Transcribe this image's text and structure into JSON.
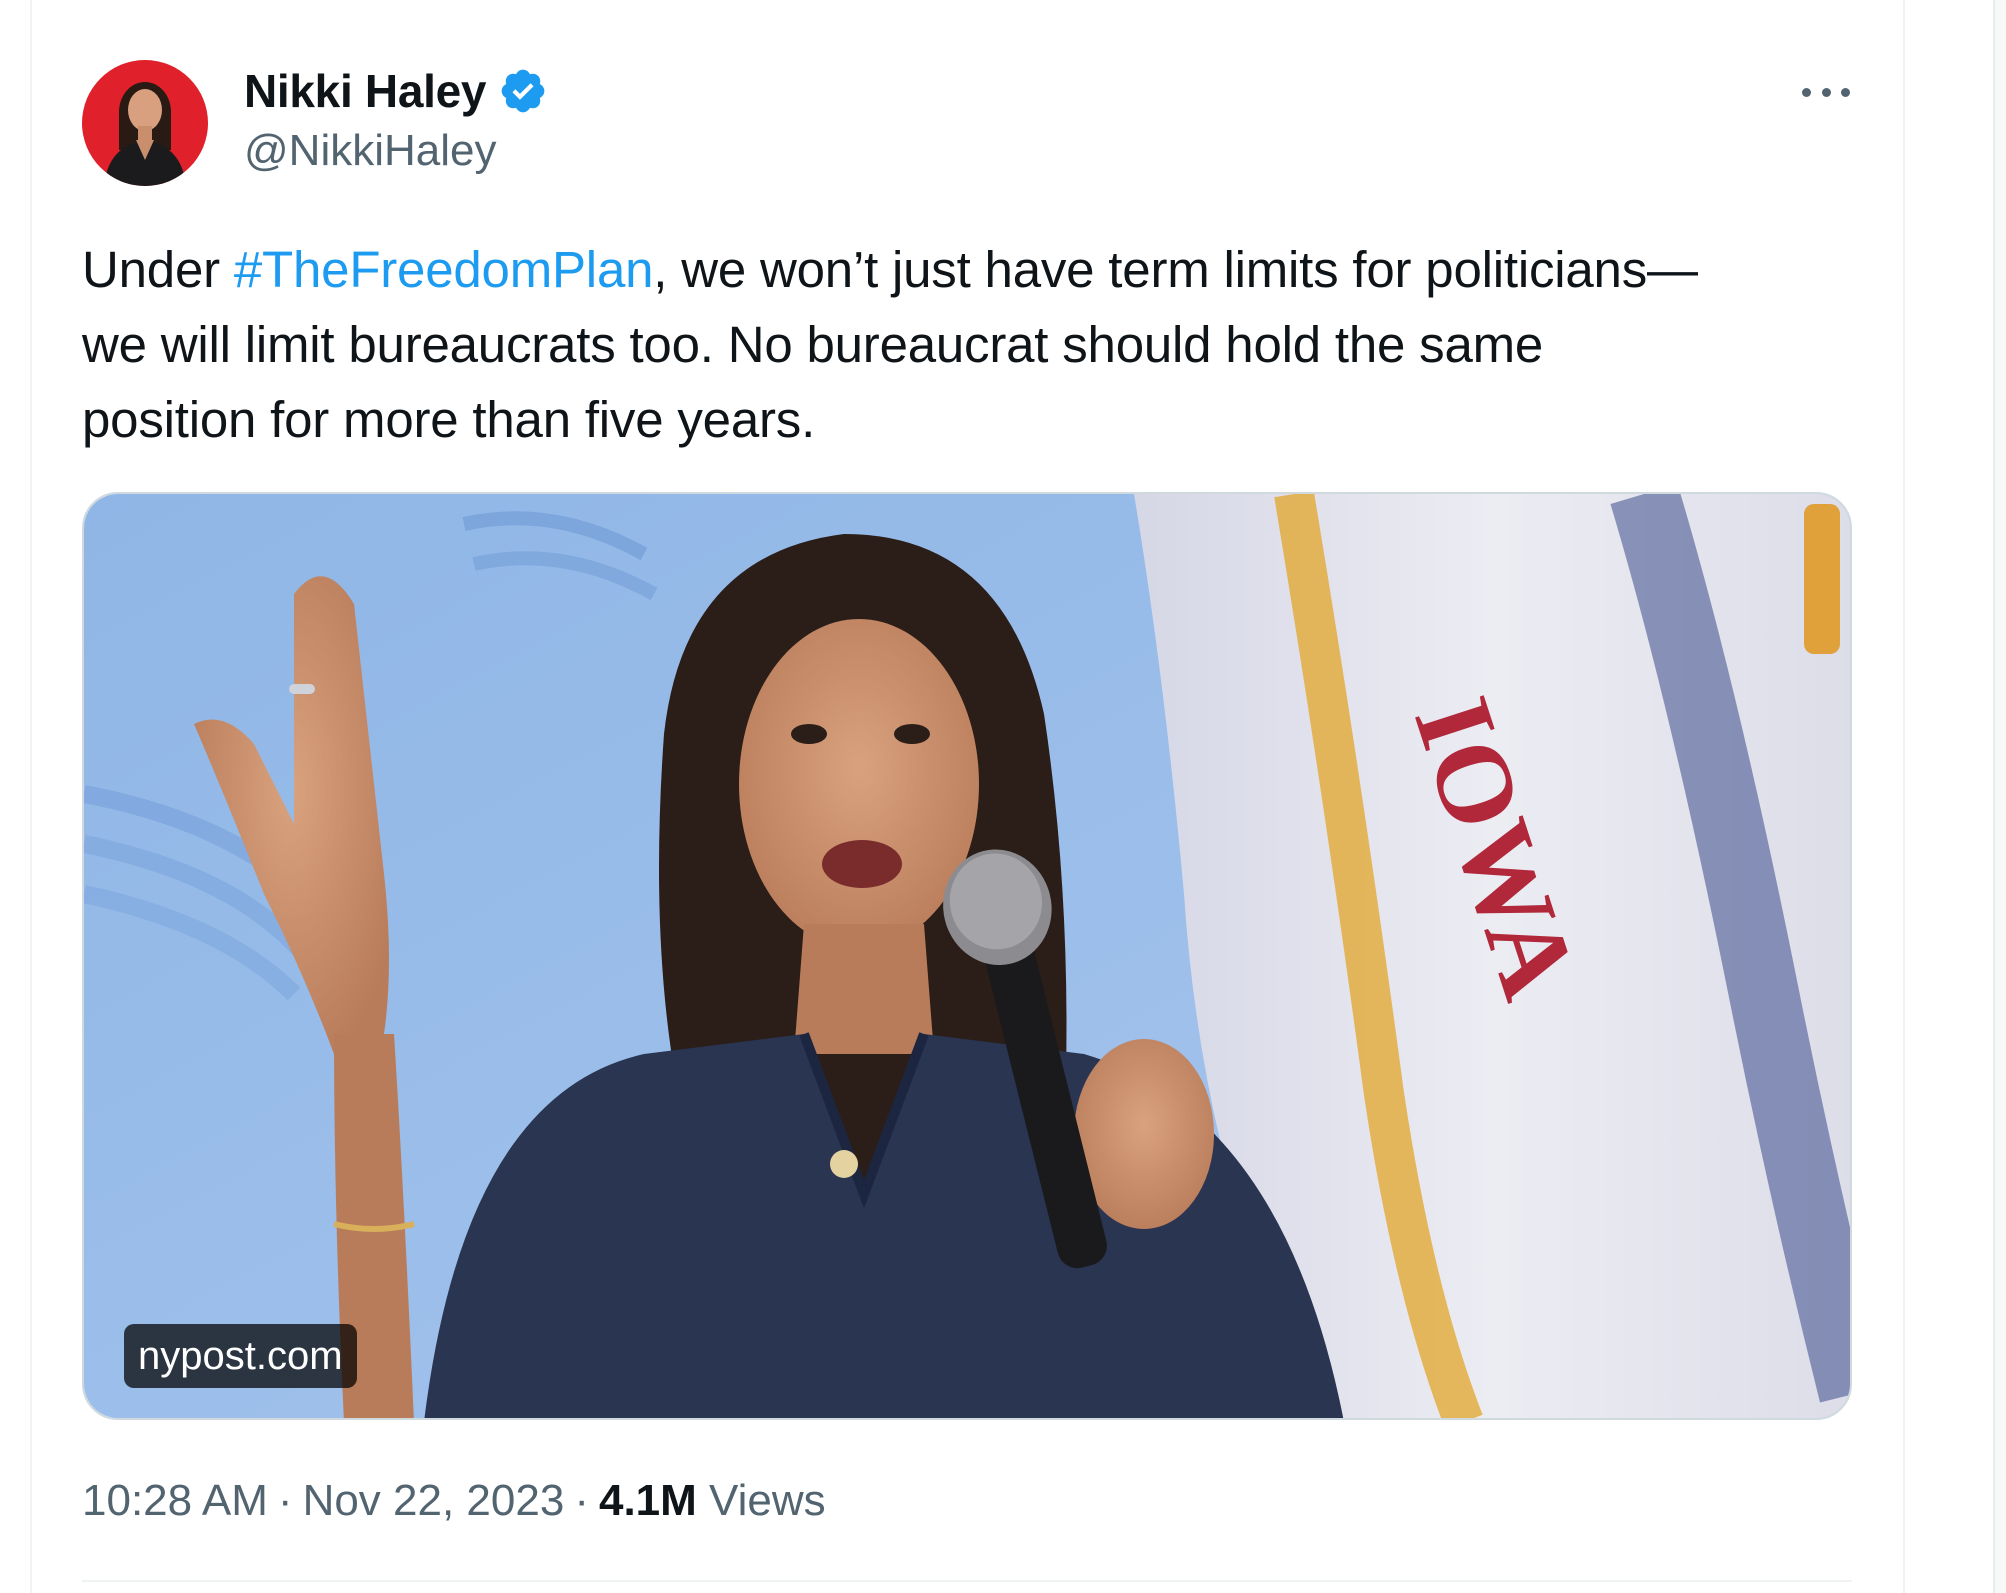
{
  "tweet": {
    "author": {
      "display_name": "Nikki Haley",
      "handle": "@NikkiHaley",
      "verified": true,
      "verified_icon": "verified-badge-icon",
      "verified_color": "#1d9bf0"
    },
    "more_icon": "more-options-icon",
    "text": {
      "line1_prefix": "Under ",
      "hashtag": "#TheFreedomPlan",
      "line1_suffix": ", we won’t just have term limits for politicians—",
      "line2": "we will limit bureaucrats too. No bureaucrat should hold the same",
      "line3": "position for more than five years."
    },
    "media": {
      "source_label": "nypost.com",
      "flag_text": "IOWA"
    },
    "meta": {
      "time": "10:28 AM",
      "separator": "·",
      "date": "Nov 22, 2023",
      "views_count": "4.1M",
      "views_label": "Views"
    }
  },
  "colors": {
    "link": "#1d9bf0",
    "text_primary": "#0f1419",
    "text_secondary": "#536471",
    "avatar_bg": "#e0202a"
  }
}
